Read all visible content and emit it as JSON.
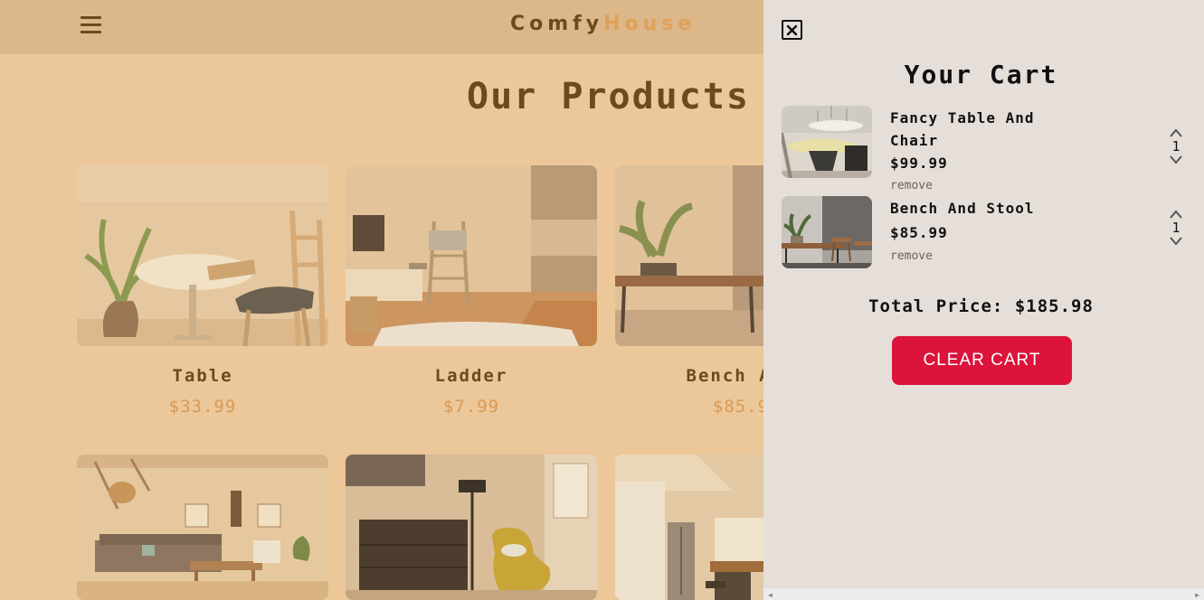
{
  "navbar": {
    "menu_icon": "hamburger-icon",
    "logo_part1": "Comfy",
    "logo_part2": "House"
  },
  "products_section": {
    "title": "Our Products",
    "products": [
      {
        "name": "Table",
        "price": "$33.99"
      },
      {
        "name": "Ladder",
        "price": "$7.99"
      },
      {
        "name": "Bench And",
        "price": "$85.9"
      },
      {
        "name": "",
        "price": ""
      },
      {
        "name": "",
        "price": ""
      },
      {
        "name": "",
        "price": ""
      }
    ]
  },
  "cart": {
    "close_icon": "close-icon",
    "title": "Your Cart",
    "items": [
      {
        "title": "Fancy Table And Chair",
        "price": "$99.99",
        "remove_label": "remove",
        "quantity": "1"
      },
      {
        "title": "Bench And Stool",
        "price": "$85.99",
        "remove_label": "remove",
        "quantity": "1"
      }
    ],
    "total_label": "Total Price:",
    "total_value": "$185.98",
    "clear_label": "CLEAR CART"
  },
  "colors": {
    "overlay_bg": "#e6dfd9",
    "page_bg": "#ecc799",
    "brand_dark": "#6b4a1e",
    "brand_accent": "#e0a058",
    "clear_button": "#dc143c"
  }
}
